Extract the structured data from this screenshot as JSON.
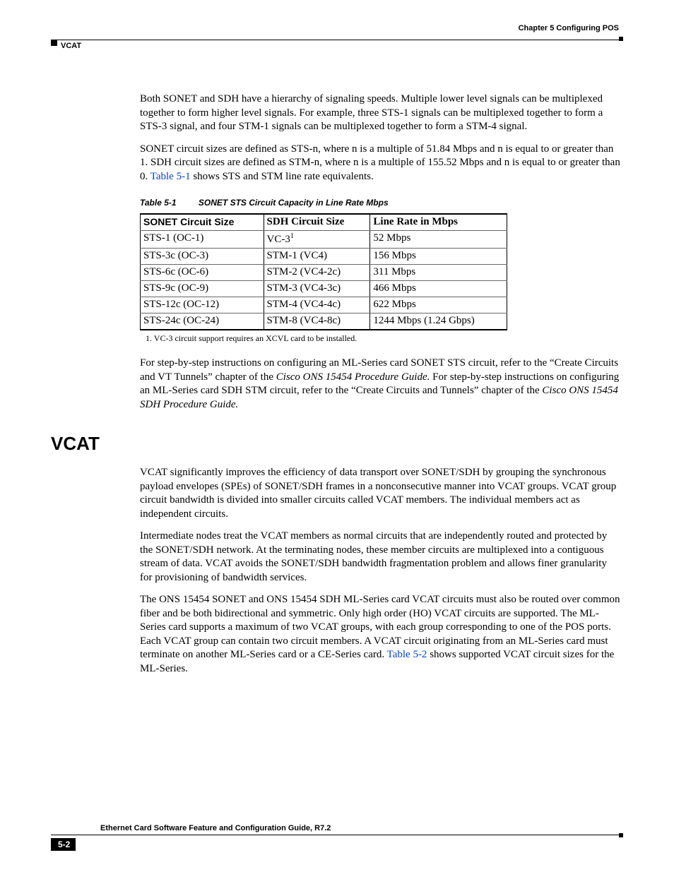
{
  "header": {
    "chapter": "Chapter 5    Configuring POS",
    "section": "VCAT"
  },
  "para1": "Both SONET and SDH have a hierarchy of signaling speeds. Multiple lower level signals can be multiplexed together to form higher level signals. For example, three STS-1 signals can be multiplexed together to form a STS-3 signal, and four STM-1 signals can be multiplexed together to form a STM-4 signal.",
  "para2a": "SONET circuit sizes are defined as STS-n, where n is a multiple of 51.84 Mbps and n is equal to or greater than 1. SDH circuit sizes are defined as STM-n, where n is a multiple of 155.52 Mbps and n is equal to or greater than 0. ",
  "xref1": "Table 5-1",
  "para2b": " shows STS and STM line rate equivalents.",
  "table1": {
    "label": "Table 5-1",
    "title": "SONET STS Circuit Capacity in Line Rate Mbps",
    "headers": [
      "SONET Circuit Size",
      "SDH Circuit Size",
      "Line Rate in Mbps"
    ],
    "rows": [
      {
        "c1": "STS-1 (OC-1)",
        "c2a": "VC-3",
        "c2sup": "1",
        "c3": "52 Mbps"
      },
      {
        "c1": "STS-3c (OC-3)",
        "c2a": "STM-1 (VC4)",
        "c2sup": "",
        "c3": "156 Mbps"
      },
      {
        "c1": "STS-6c (OC-6)",
        "c2a": "STM-2 (VC4-2c)",
        "c2sup": "",
        "c3": "311 Mbps"
      },
      {
        "c1": "STS-9c (OC-9)",
        "c2a": "STM-3 (VC4-3c)",
        "c2sup": "",
        "c3": "466 Mbps"
      },
      {
        "c1": "STS-12c (OC-12)",
        "c2a": "STM-4 (VC4-4c)",
        "c2sup": "",
        "c3": "622 Mbps"
      },
      {
        "c1": "STS-24c (OC-24)",
        "c2a": "STM-8 (VC4-8c)",
        "c2sup": "",
        "c3": "1244 Mbps (1.24 Gbps)"
      }
    ],
    "footnote": "1.   VC-3 circuit support requires an XCVL card to be installed."
  },
  "para3a": "For step-by-step instructions on configuring an ML-Series card SONET STS circuit, refer to the “Create Circuits and VT Tunnels” chapter of the ",
  "para3i1": "Cisco ONS 15454 Procedure Guide.",
  "para3b": " For step-by-step instructions on configuring an ML-Series card SDH STM circuit, refer to the “Create Circuits and Tunnels” chapter of the ",
  "para3i2": "Cisco ONS 15454 SDH Procedure Guide.",
  "h2": "VCAT",
  "para4": "VCAT significantly improves the efficiency of data transport over SONET/SDH by grouping the synchronous payload envelopes (SPEs) of SONET/SDH frames in a nonconsecutive manner into VCAT groups. VCAT group circuit bandwidth is divided into smaller circuits called VCAT members. The individual members act as independent circuits.",
  "para5": "Intermediate nodes treat the VCAT members as normal circuits that are independently routed and protected by the SONET/SDH network. At the terminating nodes, these member circuits are multiplexed into a contiguous stream of data. VCAT avoids the SONET/SDH bandwidth fragmentation problem and allows finer granularity for provisioning of bandwidth services.",
  "para6a": "The ONS 15454 SONET and ONS 15454 SDH ML-Series card VCAT circuits must also be routed over common fiber and be both bidirectional and symmetric. Only high order (HO) VCAT circuits are supported. The ML-Series card supports a maximum of two VCAT groups, with each group corresponding to one of the POS ports. Each VCAT group can contain two circuit members. A VCAT circuit originating from an ML-Series card must terminate on another ML-Series card or a CE-Series card. ",
  "xref2": "Table 5-2",
  "para6b": " shows supported VCAT circuit sizes for the ML-Series.",
  "footer": {
    "guide": "Ethernet Card Software Feature and Configuration Guide, R7.2",
    "pagenum": "5-2"
  }
}
